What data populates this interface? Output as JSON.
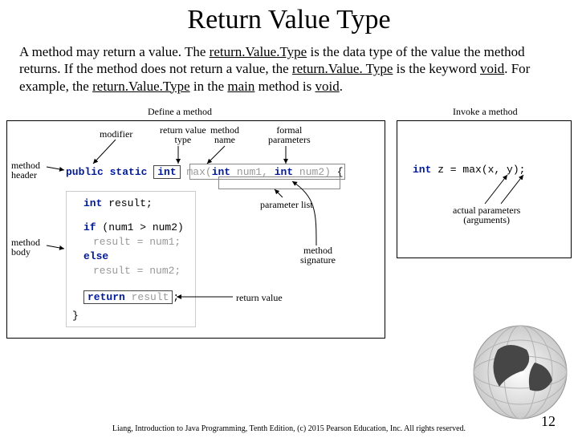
{
  "title": "Return Value Type",
  "paragraph": {
    "p1": "A method may return a value. The ",
    "u1": "return.Value.Type",
    "p2": " is the data type of the value the method returns. If the method does not return a value, the ",
    "u2": "return.Value. Type",
    "p3": " is the keyword ",
    "u3": "void",
    "p4": ". For example, the ",
    "u4": "return.Value.Type",
    "p5": " in the ",
    "u5": "main",
    "p6": " method is ",
    "u6": "void",
    "p7": "."
  },
  "labels": {
    "define": "Define a method",
    "invoke": "Invoke a method",
    "modifier": "modifier",
    "retvaltype": "return value\ntype",
    "methodname": "method\nname",
    "formalparams": "formal\nparameters",
    "methodheader": "method\nheader",
    "methodbody": "method\nbody",
    "paramlist": "parameter list",
    "methodsig": "method\nsignature",
    "retval": "return value",
    "actualparams": "actual parameters\n(arguments)"
  },
  "code": {
    "sig_public": "public",
    "sig_static": "static",
    "sig_int": "int",
    "sig_max": "max",
    "sig_open": "(",
    "sig_int2": "int",
    "sig_n1": " num1,",
    "sig_int3": "int",
    "sig_n2": " num2)",
    "sig_brace": " {",
    "l1": "int result;",
    "l2": "if (num1 > num2)",
    "l3": "  result = num1;",
    "l4": "else",
    "l5": "  result = num2;",
    "l6a": "return",
    "l6b": " result",
    "l6c": ";",
    "l7": "}",
    "inv": "int z = max(x, y);"
  },
  "footer": "Liang, Introduction to Java Programming, Tenth Edition, (c) 2015 Pearson Education, Inc. All rights reserved.",
  "pagenum": "12"
}
